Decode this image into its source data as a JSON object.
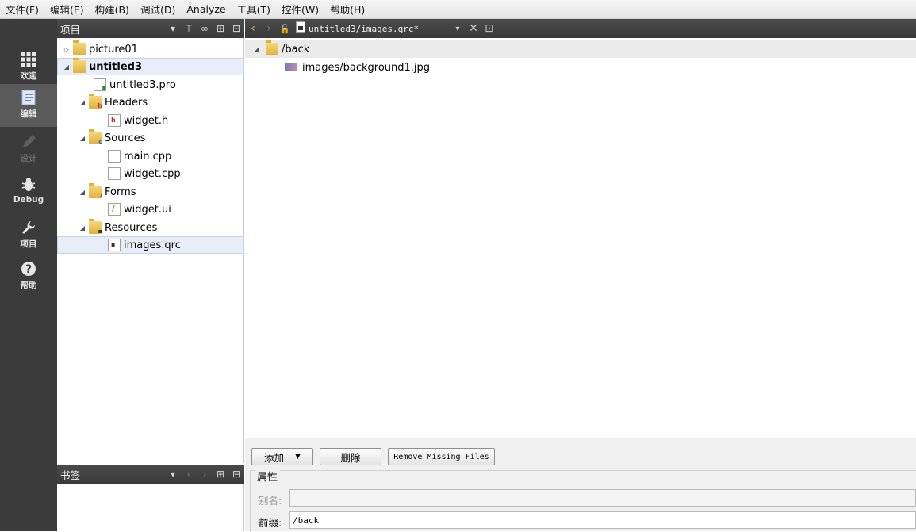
{
  "menu": [
    "文件(F)",
    "编辑(E)",
    "构建(B)",
    "调试(D)",
    "Analyze",
    "工具(T)",
    "控件(W)",
    "帮助(H)"
  ],
  "modes": [
    {
      "label": "欢迎",
      "icon": "grid-icon",
      "active": false,
      "disabled": false
    },
    {
      "label": "编辑",
      "icon": "document-icon",
      "active": true,
      "disabled": false
    },
    {
      "label": "设计",
      "icon": "pencil-icon",
      "active": false,
      "disabled": true
    },
    {
      "label": "Debug",
      "icon": "bug-icon",
      "active": false,
      "disabled": false
    },
    {
      "label": "项目",
      "icon": "wrench-icon",
      "active": false,
      "disabled": false
    },
    {
      "label": "帮助",
      "icon": "question-icon",
      "active": false,
      "disabled": false
    }
  ],
  "project_pane": {
    "title": "项目"
  },
  "tree": [
    {
      "label": "picture01",
      "expanded": false,
      "kind": "project"
    },
    {
      "label": "untitled3",
      "expanded": true,
      "kind": "project",
      "bold": true
    },
    {
      "label": "untitled3.pro",
      "kind": "pro-file"
    },
    {
      "label": "Headers",
      "expanded": true,
      "kind": "folder-h"
    },
    {
      "label": "widget.h",
      "kind": "h-file"
    },
    {
      "label": "Sources",
      "expanded": true,
      "kind": "folder-cpp"
    },
    {
      "label": "main.cpp",
      "kind": "cpp-file"
    },
    {
      "label": "widget.cpp",
      "kind": "cpp-file"
    },
    {
      "label": "Forms",
      "expanded": true,
      "kind": "folder-ui"
    },
    {
      "label": "widget.ui",
      "kind": "ui-file"
    },
    {
      "label": "Resources",
      "expanded": true,
      "kind": "folder-qrc"
    },
    {
      "label": "images.qrc",
      "kind": "qrc-file",
      "selected": true
    }
  ],
  "bookmarks_pane": {
    "title": "书签"
  },
  "editor": {
    "open_file": "untitled3/images.qrc*",
    "resource_tree": [
      {
        "label": "/back",
        "kind": "prefix"
      },
      {
        "label": "images/background1.jpg",
        "kind": "image"
      }
    ]
  },
  "buttons": {
    "add": "添加",
    "remove": "删除",
    "remove_missing": "Remove Missing Files"
  },
  "properties": {
    "title": "属性",
    "alias_label": "别名:",
    "alias_value": "",
    "prefix_label": "前缀:",
    "prefix_value": "/back"
  }
}
